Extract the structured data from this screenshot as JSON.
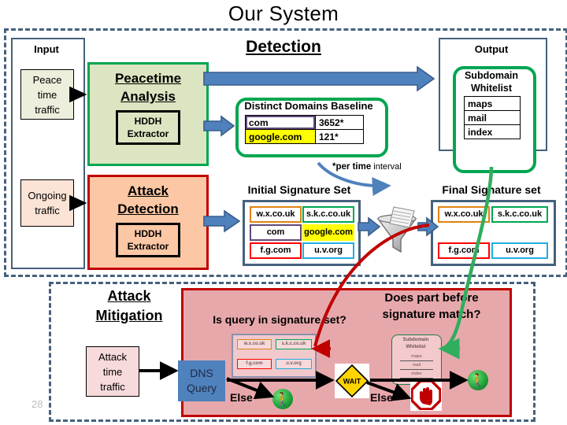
{
  "slide": {
    "title": "Our System",
    "page_number": "28"
  },
  "detection": {
    "heading": "Detection",
    "input": {
      "label": "Input",
      "peace_traffic": "Peace\ntime\ntraffic",
      "peace_traffic_lines": [
        "Peace",
        "time",
        "traffic"
      ],
      "ongoing_traffic_lines": [
        "Ongoing",
        "traffic"
      ]
    },
    "peacetime_module": {
      "title_lines": [
        "Peacetime",
        "Analysis"
      ],
      "sub_lines": [
        "HDDH",
        "Extractor"
      ]
    },
    "attack_module": {
      "title_lines": [
        "Attack",
        "Detection"
      ],
      "sub_lines": [
        "HDDH",
        "Extractor"
      ]
    },
    "baseline": {
      "title": "Distinct Domains Baseline",
      "rows": [
        {
          "domain": "com",
          "count": "3652*"
        },
        {
          "domain": "google.com",
          "count": "121*"
        }
      ],
      "footnote_bold": "*per time",
      "footnote_rest": " interval"
    },
    "output": {
      "label": "Output",
      "whitelist_title_lines": [
        "Subdomain",
        "Whitelist"
      ],
      "whitelist_items": [
        "maps",
        "mail",
        "index"
      ]
    },
    "initial_signature_set": {
      "title": "Initial Signature Set",
      "chips": [
        {
          "text": "w.x.co.uk",
          "color": "#e08214"
        },
        {
          "text": "s.k.c.co.uk",
          "color": "#00a651"
        },
        {
          "text": "com",
          "color": "#60497a"
        },
        {
          "text": "google.com",
          "color": "#ffff00"
        },
        {
          "text": "f.g.com",
          "color": "#ff0000"
        },
        {
          "text": "u.v.org",
          "color": "#22aee0"
        }
      ]
    },
    "final_signature_set": {
      "title": "Final Signature set",
      "chips": [
        {
          "text": "w.x.co.uk",
          "color": "#e08214"
        },
        {
          "text": "s.k.c.co.uk",
          "color": "#00a651"
        },
        {
          "text": "f.g.com",
          "color": "#ff0000"
        },
        {
          "text": "u.v.org",
          "color": "#22aee0"
        }
      ]
    },
    "funnel_icon": "funnel-icon"
  },
  "mitigation": {
    "heading_lines": [
      "Attack",
      "Mitigation"
    ],
    "attack_traffic_lines": [
      "Attack",
      "time",
      "traffic"
    ],
    "dns_query_lines": [
      "DNS",
      "Query"
    ],
    "question_signature": "Is query in signature set?",
    "question_match_lines": [
      "Does part before",
      "signature match?"
    ],
    "mini_signature_chips": [
      {
        "text": "w.x.co.uk",
        "color": "#e08214"
      },
      {
        "text": "s.k.c.co.uk",
        "color": "#00a651"
      },
      {
        "text": "f.g.com",
        "color": "#ff0000"
      },
      {
        "text": "u.v.org",
        "color": "#22aee0"
      }
    ],
    "mini_whitelist_title_lines": [
      "Subdomain",
      "Whitelist"
    ],
    "mini_whitelist_items": [
      "maps",
      "mail",
      "index"
    ],
    "wait_sign_label": "WAIT",
    "else_label_1": "Else",
    "else_label_2": "Else",
    "allow_icon_1": "pedestrian-walk-icon",
    "allow_icon_2": "pedestrian-walk-icon",
    "stop_icon": "stop-hand-icon"
  },
  "colors": {
    "frame_blue": "#45617d",
    "green": "#00a651",
    "red": "#c00000",
    "arrow_blue": "#4f81bd"
  }
}
